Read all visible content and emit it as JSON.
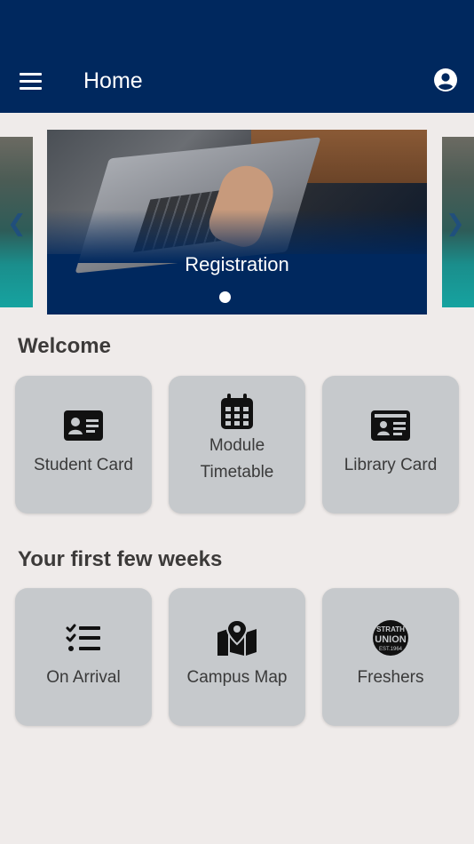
{
  "app_bar": {
    "title": "Home",
    "menu_icon": "menu-icon",
    "account_icon": "account-circle-icon",
    "color": "#00285e"
  },
  "carousel": {
    "slides": [
      {
        "caption": "Registration"
      }
    ],
    "active_index": 0
  },
  "sections": [
    {
      "title": "Welcome",
      "tiles": [
        {
          "label": "Student Card",
          "icon": "id-card-icon"
        },
        {
          "label": "Module\nTimetable",
          "icon": "calendar-icon"
        },
        {
          "label": "Library Card",
          "icon": "library-card-icon"
        }
      ]
    },
    {
      "title": "Your first few weeks",
      "tiles": [
        {
          "label": "On Arrival",
          "icon": "checklist-icon"
        },
        {
          "label": "Campus Map",
          "icon": "map-pin-icon"
        },
        {
          "label": "Freshers",
          "icon": "strath-union-logo"
        }
      ]
    }
  ]
}
